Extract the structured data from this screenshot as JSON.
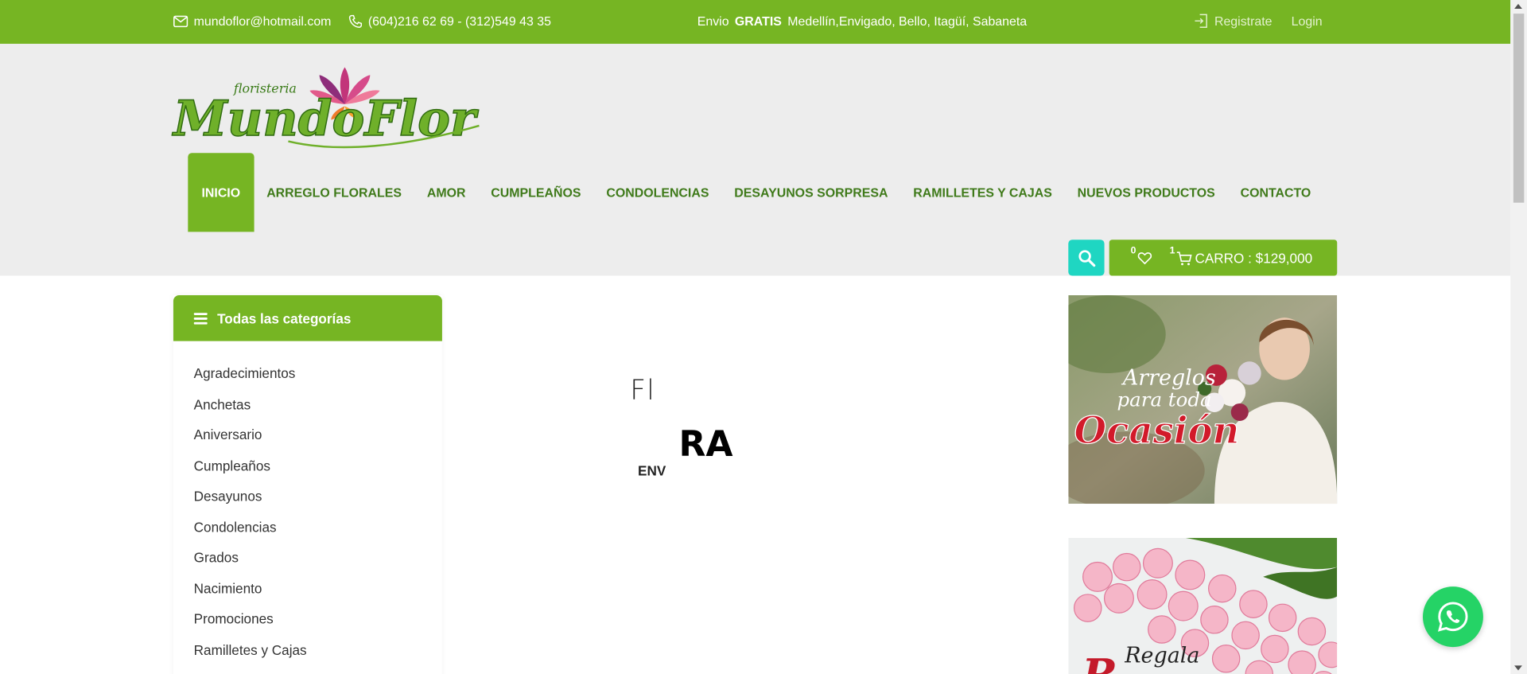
{
  "topbar": {
    "email": "mundoflor@hotmail.com",
    "phone": "(604)216 62 69 - (312)549 43 35",
    "shipping_prefix": "Envio",
    "shipping_bold": "GRATIS",
    "shipping_rest": "Medellín,Envigado, Bello, Itagüí, Sabaneta",
    "register": "Registrate",
    "login": "Login"
  },
  "logo": {
    "small": "floristeria",
    "main": "MundoFlor"
  },
  "nav": {
    "items": [
      {
        "label": "INICIO"
      },
      {
        "label": "ARREGLO FLORALES"
      },
      {
        "label": "AMOR"
      },
      {
        "label": "CUMPLEAÑOS"
      },
      {
        "label": "CONDOLENCIAS"
      },
      {
        "label": "DESAYUNOS SORPRESA"
      },
      {
        "label": "RAMILLETES Y CAJAS"
      },
      {
        "label": "NUEVOS PRODUCTOS"
      },
      {
        "label": "CONTACTO"
      }
    ]
  },
  "cart": {
    "wishlist_count": "0",
    "cart_count": "1",
    "label": "CARRO : $129,000"
  },
  "sidebar": {
    "title": "Todas las categorías",
    "categories": [
      "Agradecimientos",
      "Anchetas",
      "Aniversario",
      "Cumpleaños",
      "Desayunos",
      "Condolencias",
      "Grados",
      "Nacimiento",
      "Promociones",
      "Ramilletes y Cajas"
    ]
  },
  "slider": {
    "line1": "Fl",
    "line2": "RA",
    "line3": "ENV"
  },
  "banners": {
    "b1_line1": "Arreglos",
    "b1_line2": "para toda",
    "b1_line3": "Ocasión",
    "b2_line1": "Regala"
  },
  "colors": {
    "primary": "#76b523",
    "nav_text": "#3f7a1a",
    "search": "#1fd6c2",
    "whatsapp": "#25d366"
  },
  "icons": [
    "mail-icon",
    "phone-icon",
    "login-icon",
    "search-icon",
    "heart-icon",
    "cart-icon",
    "bars-icon",
    "whatsapp-icon"
  ]
}
